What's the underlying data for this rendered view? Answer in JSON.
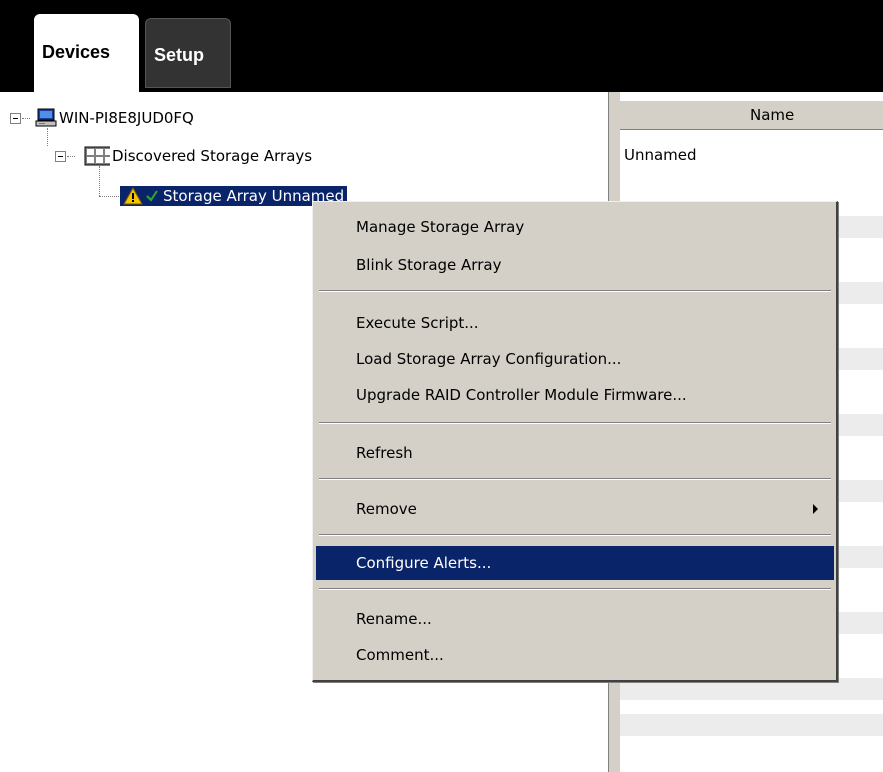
{
  "tabs": [
    {
      "label": "Devices",
      "active": true
    },
    {
      "label": "Setup",
      "active": false
    }
  ],
  "tree": {
    "host": {
      "label": "WIN-PI8E8JUD0FQ",
      "icon": "computer-icon"
    },
    "group": {
      "label": "Discovered Storage Arrays",
      "icon": "storage-arrays-icon"
    },
    "array": {
      "label": "Storage Array Unnamed",
      "icons": [
        "warning-icon",
        "check-icon"
      ]
    }
  },
  "table": {
    "columns": [
      "Name"
    ],
    "rows": [
      [
        "Unnamed"
      ]
    ]
  },
  "context_menu": {
    "items": [
      {
        "label": "Manage Storage Array"
      },
      {
        "label": "Blink Storage Array"
      },
      {
        "label": "Execute Script..."
      },
      {
        "label": "Load Storage Array Configuration..."
      },
      {
        "label": "Upgrade RAID Controller Module Firmware..."
      },
      {
        "label": "Refresh"
      },
      {
        "label": "Remove",
        "submenu": true
      },
      {
        "label": "Configure Alerts...",
        "highlighted": true
      },
      {
        "label": "Rename..."
      },
      {
        "label": "Comment..."
      }
    ]
  },
  "colors": {
    "selection": "#0a246a",
    "menu_bg": "#d4d0c8",
    "warning": "#f5c400",
    "check": "#2fa82f"
  }
}
